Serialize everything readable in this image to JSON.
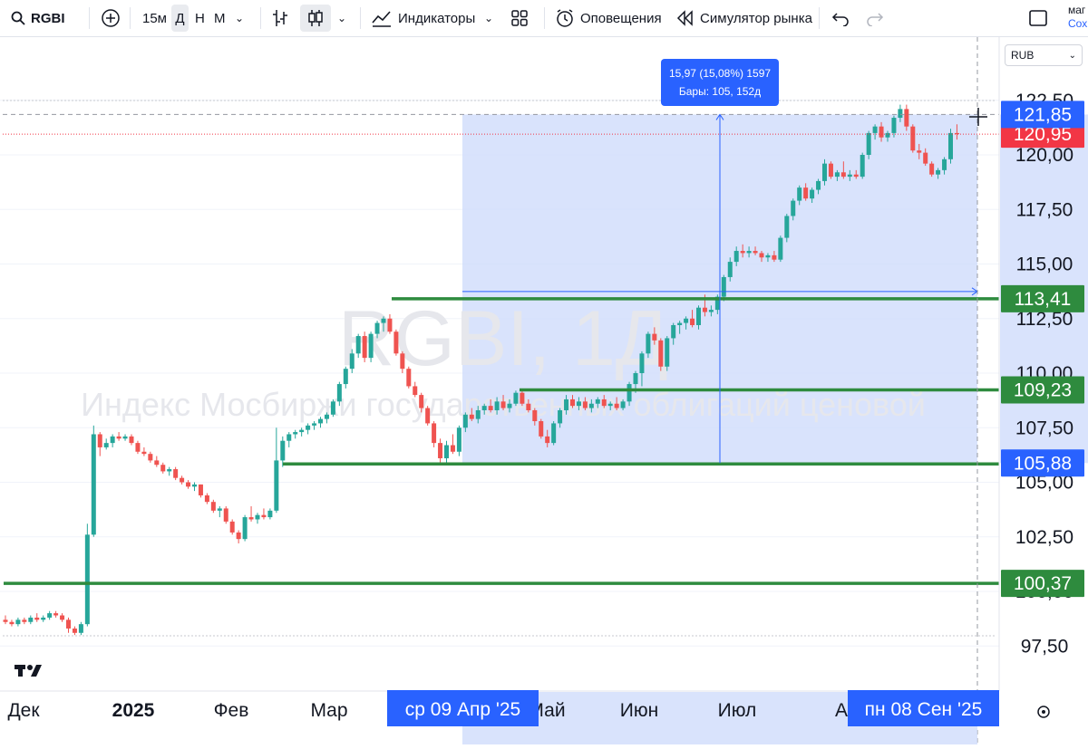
{
  "toolbar": {
    "symbol": "RGBI",
    "intervals": [
      "15м",
      "Д",
      "Н",
      "М"
    ],
    "active_interval": "Д",
    "indicators_label": "Индикаторы",
    "alerts_label": "Оповещения",
    "replay_label": "Симулятор рынка",
    "save_top": "маг",
    "save_bottom": "Сохра"
  },
  "watermark": {
    "symbol_line": "RGBI, 1Д",
    "description": "Индекс Мосбиржи государственных облигаций ценовой"
  },
  "currency": "RUB",
  "price_axis": {
    "ticks": [
      "122,50",
      "120,00",
      "117,50",
      "115,00",
      "112,50",
      "110,00",
      "107,50",
      "105,00",
      "102,50",
      "100,00",
      "97,50"
    ]
  },
  "price_tags": [
    {
      "label": "121,85",
      "type": "crosshair",
      "color": "#2962ff"
    },
    {
      "label": "120,95",
      "type": "last_price",
      "color": "#f23645"
    },
    {
      "label": "113,41",
      "type": "level",
      "color": "#2e8b3e"
    },
    {
      "label": "109,23",
      "type": "level",
      "color": "#2e8b3e"
    },
    {
      "label": "105,88",
      "type": "range",
      "color": "#2962ff"
    },
    {
      "label": "100,37",
      "type": "level",
      "color": "#2e8b3e"
    }
  ],
  "measure": {
    "line1": "15,97 (15,08%) 1597",
    "line2": "Бары: 105, 152д"
  },
  "time_axis": {
    "labels": [
      "Дек",
      "2025",
      "Фев",
      "Мар",
      "Май",
      "Июн",
      "Июл",
      "А"
    ],
    "range_start": "ср 09 Апр '25",
    "range_end": "пн 08 Сен '25"
  },
  "chart_data": {
    "type": "candlestick",
    "symbol": "RGBI",
    "interval": "1Д",
    "currency": "RUB",
    "ylim": [
      97.5,
      122.5
    ],
    "series": [
      {
        "values": [
          [
            98.7,
            98.9,
            98.5,
            98.6
          ],
          [
            98.6,
            98.7,
            98.4,
            98.5
          ],
          [
            98.5,
            98.8,
            98.4,
            98.7
          ],
          [
            98.7,
            98.8,
            98.5,
            98.6
          ],
          [
            98.6,
            98.9,
            98.5,
            98.8
          ],
          [
            98.8,
            99.0,
            98.6,
            98.7
          ],
          [
            98.7,
            98.9,
            98.6,
            98.8
          ],
          [
            98.8,
            99.1,
            98.7,
            99.0
          ],
          [
            99.0,
            99.1,
            98.8,
            98.9
          ],
          [
            98.9,
            99.0,
            98.6,
            98.7
          ],
          [
            98.7,
            98.8,
            98.1,
            98.3
          ],
          [
            98.3,
            98.4,
            98.0,
            98.1
          ],
          [
            98.1,
            98.6,
            98.0,
            98.5
          ],
          [
            98.5,
            103.1,
            98.4,
            102.6
          ],
          [
            102.6,
            107.6,
            102.5,
            107.2
          ],
          [
            107.2,
            107.3,
            106.2,
            106.6
          ],
          [
            106.6,
            107.0,
            106.5,
            106.8
          ],
          [
            106.8,
            107.2,
            106.6,
            107.1
          ],
          [
            107.1,
            107.3,
            106.9,
            107.0
          ],
          [
            107.0,
            107.2,
            106.9,
            107.1
          ],
          [
            107.1,
            107.2,
            106.7,
            106.8
          ],
          [
            106.8,
            106.9,
            106.3,
            106.4
          ],
          [
            106.4,
            106.6,
            106.2,
            106.3
          ],
          [
            106.3,
            106.4,
            105.9,
            106.0
          ],
          [
            106.0,
            106.2,
            105.7,
            105.8
          ],
          [
            105.8,
            105.9,
            105.4,
            105.5
          ],
          [
            105.5,
            105.7,
            105.3,
            105.6
          ],
          [
            105.6,
            105.7,
            105.1,
            105.2
          ],
          [
            105.2,
            105.3,
            104.9,
            105.0
          ],
          [
            105.0,
            105.1,
            104.7,
            104.8
          ],
          [
            104.8,
            105.0,
            104.6,
            104.9
          ],
          [
            104.9,
            104.9,
            104.3,
            104.4
          ],
          [
            104.4,
            104.5,
            104.0,
            104.1
          ],
          [
            104.1,
            104.2,
            103.6,
            103.7
          ],
          [
            103.7,
            103.9,
            103.4,
            103.8
          ],
          [
            103.8,
            103.9,
            103.1,
            103.2
          ],
          [
            103.2,
            103.3,
            102.6,
            102.7
          ],
          [
            102.7,
            102.8,
            102.2,
            102.4
          ],
          [
            102.4,
            103.5,
            102.3,
            103.4
          ],
          [
            103.4,
            103.9,
            103.2,
            103.3
          ],
          [
            103.3,
            103.6,
            103.1,
            103.5
          ],
          [
            103.5,
            103.8,
            103.3,
            103.4
          ],
          [
            103.4,
            103.8,
            103.3,
            103.7
          ],
          [
            103.7,
            107.5,
            103.6,
            106.0
          ],
          [
            106.0,
            107.1,
            105.7,
            106.9
          ],
          [
            106.9,
            107.3,
            106.6,
            107.2
          ],
          [
            107.2,
            107.4,
            107.0,
            107.3
          ],
          [
            107.3,
            107.5,
            107.1,
            107.4
          ],
          [
            107.4,
            107.7,
            107.2,
            107.6
          ],
          [
            107.6,
            107.8,
            107.4,
            107.7
          ],
          [
            107.7,
            108.0,
            107.5,
            107.9
          ],
          [
            107.9,
            108.2,
            107.7,
            108.1
          ],
          [
            108.1,
            108.8,
            108.0,
            108.7
          ],
          [
            108.7,
            109.6,
            108.5,
            109.5
          ],
          [
            109.5,
            110.3,
            109.3,
            110.2
          ],
          [
            110.2,
            111.1,
            110.0,
            110.9
          ],
          [
            110.9,
            111.8,
            110.7,
            111.7
          ],
          [
            111.7,
            111.9,
            110.5,
            110.7
          ],
          [
            110.7,
            111.9,
            110.5,
            111.8
          ],
          [
            111.8,
            112.4,
            111.6,
            112.3
          ],
          [
            112.3,
            112.6,
            111.9,
            112.5
          ],
          [
            112.5,
            112.7,
            111.8,
            111.9
          ],
          [
            111.9,
            112.0,
            110.8,
            110.9
          ],
          [
            110.9,
            111.0,
            110.0,
            110.2
          ],
          [
            110.2,
            110.3,
            109.3,
            109.4
          ],
          [
            109.4,
            109.6,
            108.9,
            109.0
          ],
          [
            109.0,
            109.1,
            108.2,
            108.4
          ],
          [
            108.4,
            108.5,
            107.6,
            107.7
          ],
          [
            107.7,
            107.8,
            106.6,
            106.8
          ],
          [
            106.8,
            107.0,
            105.9,
            106.1
          ],
          [
            106.1,
            106.9,
            105.9,
            106.7
          ],
          [
            106.7,
            107.2,
            106.3,
            106.4
          ],
          [
            106.4,
            107.6,
            106.2,
            107.5
          ],
          [
            107.5,
            108.2,
            107.3,
            108.1
          ],
          [
            108.1,
            108.4,
            107.8,
            107.9
          ],
          [
            107.9,
            108.5,
            107.7,
            108.3
          ],
          [
            108.3,
            108.6,
            108.1,
            108.5
          ],
          [
            108.5,
            108.8,
            108.2,
            108.3
          ],
          [
            108.3,
            108.9,
            108.1,
            108.7
          ],
          [
            108.7,
            109.0,
            108.3,
            108.4
          ],
          [
            108.4,
            108.8,
            108.2,
            108.6
          ],
          [
            108.6,
            109.2,
            108.5,
            109.1
          ],
          [
            109.1,
            109.2,
            108.5,
            108.6
          ],
          [
            108.6,
            108.8,
            108.2,
            108.3
          ],
          [
            108.3,
            108.4,
            107.6,
            107.8
          ],
          [
            107.8,
            107.9,
            107.0,
            107.1
          ],
          [
            107.1,
            107.4,
            106.6,
            106.8
          ],
          [
            106.8,
            107.8,
            106.7,
            107.7
          ],
          [
            107.7,
            108.4,
            107.5,
            108.3
          ],
          [
            108.3,
            109.0,
            108.1,
            108.8
          ],
          [
            108.8,
            109.0,
            108.4,
            108.5
          ],
          [
            108.5,
            108.9,
            108.3,
            108.7
          ],
          [
            108.7,
            108.9,
            108.3,
            108.4
          ],
          [
            108.4,
            108.8,
            108.2,
            108.6
          ],
          [
            108.6,
            108.9,
            108.4,
            108.8
          ],
          [
            108.8,
            109.0,
            108.4,
            108.5
          ],
          [
            108.5,
            108.7,
            108.3,
            108.6
          ],
          [
            108.6,
            108.9,
            108.3,
            108.4
          ],
          [
            108.4,
            108.8,
            108.3,
            108.7
          ],
          [
            108.7,
            109.6,
            108.5,
            109.5
          ],
          [
            109.5,
            110.1,
            109.1,
            110.0
          ],
          [
            110.0,
            111.0,
            109.4,
            110.9
          ],
          [
            110.9,
            111.9,
            110.7,
            111.8
          ],
          [
            111.8,
            112.1,
            111.3,
            111.5
          ],
          [
            111.5,
            111.6,
            110.1,
            110.3
          ],
          [
            110.3,
            111.7,
            110.1,
            111.6
          ],
          [
            111.6,
            112.3,
            111.3,
            112.2
          ],
          [
            112.2,
            112.4,
            111.8,
            112.3
          ],
          [
            112.3,
            112.6,
            112.0,
            112.5
          ],
          [
            112.5,
            112.9,
            112.1,
            112.2
          ],
          [
            112.2,
            113.1,
            112.0,
            113.0
          ],
          [
            113.0,
            113.6,
            112.6,
            112.8
          ],
          [
            112.8,
            113.1,
            112.6,
            112.9
          ],
          [
            112.9,
            113.6,
            112.7,
            113.5
          ],
          [
            113.5,
            114.5,
            113.3,
            114.4
          ],
          [
            114.4,
            115.3,
            114.2,
            115.1
          ],
          [
            115.1,
            115.8,
            114.9,
            115.6
          ],
          [
            115.6,
            115.9,
            115.3,
            115.5
          ],
          [
            115.5,
            115.8,
            115.3,
            115.6
          ],
          [
            115.6,
            115.8,
            115.4,
            115.5
          ],
          [
            115.5,
            115.6,
            115.1,
            115.3
          ],
          [
            115.3,
            115.5,
            115.1,
            115.4
          ],
          [
            115.4,
            115.6,
            115.1,
            115.2
          ],
          [
            115.2,
            116.3,
            115.1,
            116.2
          ],
          [
            116.2,
            117.3,
            116.0,
            117.2
          ],
          [
            117.2,
            118.0,
            117.0,
            117.9
          ],
          [
            117.9,
            118.6,
            117.7,
            118.5
          ],
          [
            118.5,
            118.7,
            117.9,
            118.0
          ],
          [
            118.0,
            118.5,
            117.8,
            118.4
          ],
          [
            118.4,
            118.9,
            118.2,
            118.8
          ],
          [
            118.8,
            119.8,
            118.6,
            119.6
          ],
          [
            119.6,
            119.7,
            118.9,
            119.0
          ],
          [
            119.0,
            119.3,
            118.8,
            119.2
          ],
          [
            119.2,
            119.7,
            118.9,
            119.0
          ],
          [
            119.0,
            119.3,
            118.8,
            119.1
          ],
          [
            119.1,
            119.3,
            118.9,
            119.0
          ],
          [
            119.0,
            120.1,
            118.9,
            120.0
          ],
          [
            120.0,
            121.1,
            119.8,
            121.0
          ],
          [
            121.0,
            121.4,
            120.7,
            121.3
          ],
          [
            121.3,
            121.5,
            120.6,
            120.8
          ],
          [
            120.8,
            121.1,
            120.6,
            121.0
          ],
          [
            121.0,
            121.8,
            120.8,
            121.7
          ],
          [
            121.7,
            122.3,
            121.5,
            122.1
          ],
          [
            122.1,
            122.3,
            121.1,
            121.3
          ],
          [
            121.3,
            121.4,
            120.1,
            120.2
          ],
          [
            120.2,
            120.5,
            119.8,
            120.1
          ],
          [
            120.1,
            120.3,
            119.5,
            119.6
          ],
          [
            119.6,
            119.7,
            119.0,
            119.1
          ],
          [
            119.1,
            119.4,
            118.9,
            119.3
          ],
          [
            119.3,
            119.9,
            119.1,
            119.8
          ],
          [
            119.8,
            121.2,
            119.6,
            121.0
          ],
          [
            121.0,
            121.4,
            120.7,
            120.95
          ]
        ]
      }
    ]
  },
  "colors": {
    "up": "#26a69a",
    "down": "#ef5350",
    "level_line": "#2e8b3e",
    "range_fill": "#cfdcfb",
    "accent": "#2962ff",
    "last_price": "#f23645"
  }
}
